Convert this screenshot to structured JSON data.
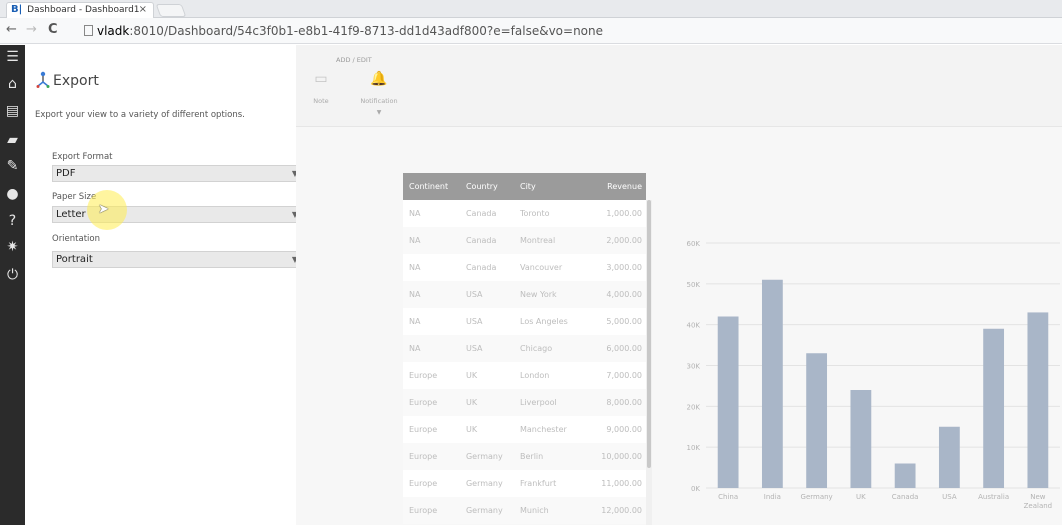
{
  "browser": {
    "tab_title": "Dashboard - Dashboard1",
    "tab_close": "×",
    "favicon": "B|",
    "url_host": "vladk",
    "url_rest": ":8010/Dashboard/54c3f0b1-e8b1-41f9-8713-dd1d43adf800?e=false&vo=none",
    "back": "←",
    "forward": "→",
    "reload": "C"
  },
  "rail": {
    "icons": [
      "menu-icon",
      "home-icon",
      "dashboard-icon",
      "notes-icon",
      "pin-icon",
      "user-icon",
      "help-icon",
      "settings-icon",
      "power-icon"
    ],
    "glyphs": [
      "☰",
      "⌂",
      "▤",
      "▰",
      "✎",
      "●",
      "?",
      "✷",
      "⏻"
    ]
  },
  "export_panel": {
    "title": "Export",
    "description": "Export your view to a variety of different options.",
    "format_label": "Export Format",
    "format_value": "PDF",
    "paper_label": "Paper Size",
    "paper_value": "Letter",
    "orientation_label": "Orientation",
    "orientation_value": "Portrait",
    "caret": "▼",
    "cursor": "➤"
  },
  "toolbar": {
    "section_label": "ADD / EDIT",
    "note_label": "Note",
    "notification_label": "Notification",
    "note_glyph": "▭",
    "notification_glyph": "🔔",
    "chevron": "▼"
  },
  "table": {
    "columns": [
      "Continent",
      "Country",
      "City",
      "Revenue"
    ],
    "rows": [
      [
        "NA",
        "Canada",
        "Toronto",
        "1,000.00"
      ],
      [
        "NA",
        "Canada",
        "Montreal",
        "2,000.00"
      ],
      [
        "NA",
        "Canada",
        "Vancouver",
        "3,000.00"
      ],
      [
        "NA",
        "USA",
        "New York",
        "4,000.00"
      ],
      [
        "NA",
        "USA",
        "Los Angeles",
        "5,000.00"
      ],
      [
        "NA",
        "USA",
        "Chicago",
        "6,000.00"
      ],
      [
        "Europe",
        "UK",
        "London",
        "7,000.00"
      ],
      [
        "Europe",
        "UK",
        "Liverpool",
        "8,000.00"
      ],
      [
        "Europe",
        "UK",
        "Manchester",
        "9,000.00"
      ],
      [
        "Europe",
        "Germany",
        "Berlin",
        "10,000.00"
      ],
      [
        "Europe",
        "Germany",
        "Frankfurt",
        "11,000.00"
      ],
      [
        "Europe",
        "Germany",
        "Munich",
        "12,000.00"
      ]
    ]
  },
  "chart_data": {
    "type": "bar",
    "categories": [
      "China",
      "India",
      "Germany",
      "UK",
      "Canada",
      "USA",
      "Australia",
      "New Zealand"
    ],
    "values": [
      42000,
      51000,
      33000,
      24000,
      6000,
      15000,
      39000,
      43000
    ],
    "yticks": [
      "0K",
      "10K",
      "20K",
      "30K",
      "40K",
      "50K",
      "60K"
    ],
    "ylim": [
      0,
      60000
    ],
    "color": "#a9b6c8",
    "grid": true
  }
}
